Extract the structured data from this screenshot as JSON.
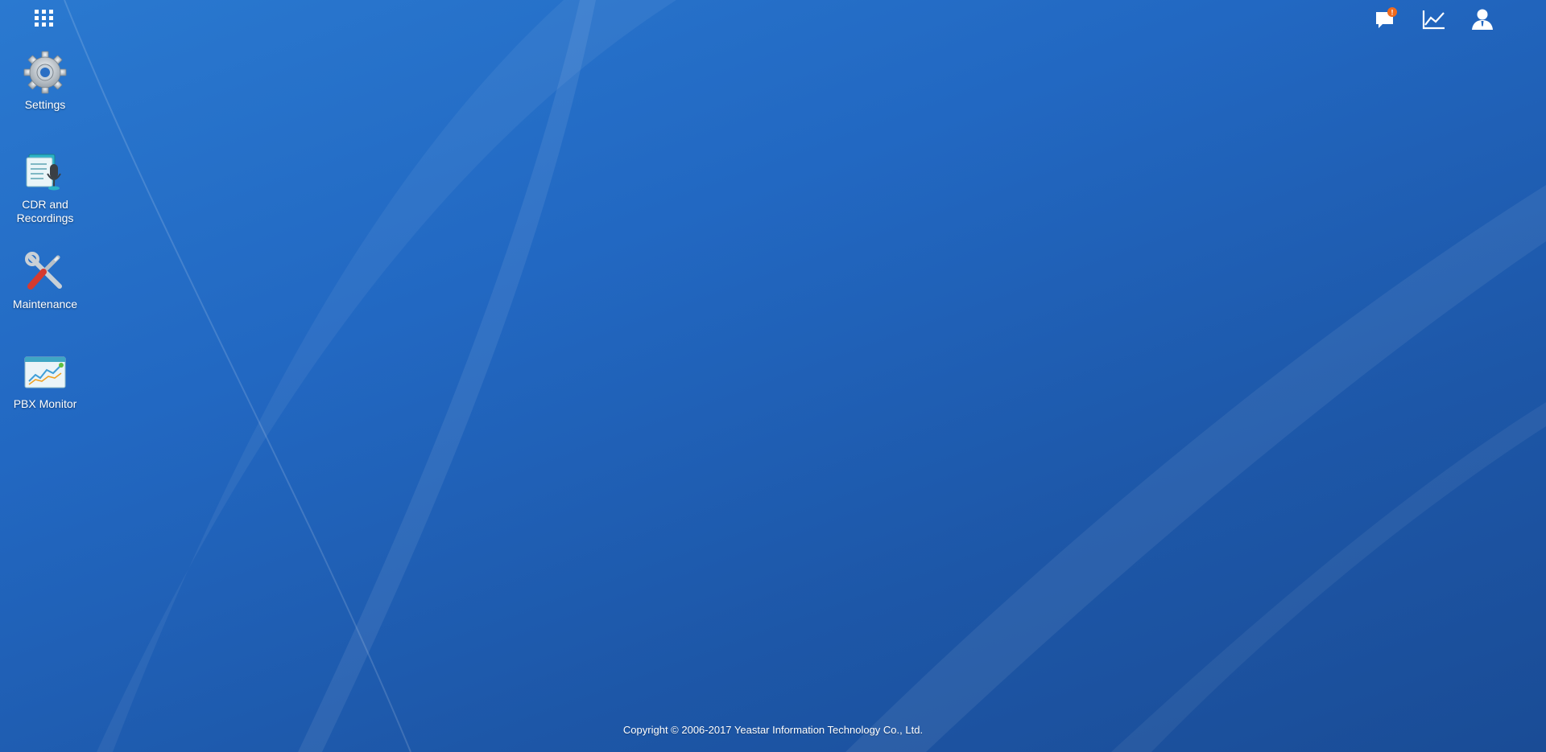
{
  "desktop": {
    "launcher_icon": "apps-grid-icon",
    "icons": [
      {
        "label": "Settings",
        "icon": "gear-icon"
      },
      {
        "label": "CDR and Recordings",
        "icon": "cdr-recordings-icon"
      },
      {
        "label": "Maintenance",
        "icon": "tools-icon"
      },
      {
        "label": "PBX Monitor",
        "icon": "monitor-chart-icon"
      }
    ]
  },
  "topbar": {
    "icons": [
      "notification-icon",
      "statistics-icon",
      "user-icon"
    ],
    "notification_badge": "!",
    "badge_color": "#f06a1d"
  },
  "footer": {
    "copyright": "Copyright © 2006-2017 Yeastar Information Technology Co., Ltd."
  },
  "colors": {
    "background": "#2268c2",
    "text": "#ffffff"
  }
}
